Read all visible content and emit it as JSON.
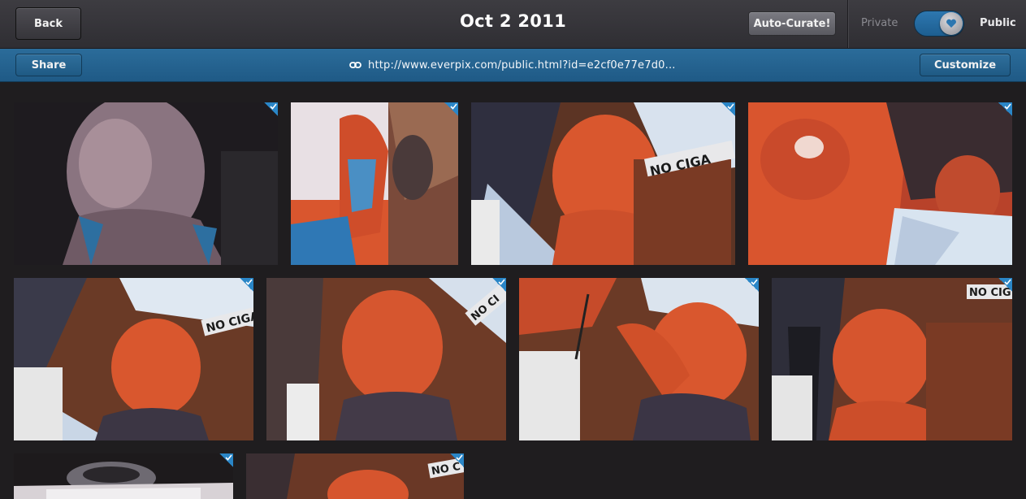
{
  "header": {
    "back_label": "Back",
    "title": "Oct 2 2011",
    "auto_curate_label": "Auto-Curate!",
    "privacy": {
      "private_label": "Private",
      "public_label": "Public",
      "state": "Public"
    }
  },
  "share_bar": {
    "share_label": "Share",
    "link_icon": "link-icon",
    "url": "http://www.everpix.com/public.html?id=e2cf0e77e7d0...",
    "customize_label": "Customize"
  },
  "photos": [
    {
      "id": 1,
      "selected": true
    },
    {
      "id": 2,
      "selected": true
    },
    {
      "id": 3,
      "selected": true
    },
    {
      "id": 4,
      "selected": true
    },
    {
      "id": 5,
      "selected": true
    },
    {
      "id": 6,
      "selected": true
    },
    {
      "id": 7,
      "selected": true
    },
    {
      "id": 8,
      "selected": true
    },
    {
      "id": 9,
      "selected": true
    },
    {
      "id": 10,
      "selected": true
    }
  ],
  "colors": {
    "accent_blue": "#2a86c7",
    "share_bar_blue": "#1f5a86",
    "background": "#1f1d1f"
  }
}
